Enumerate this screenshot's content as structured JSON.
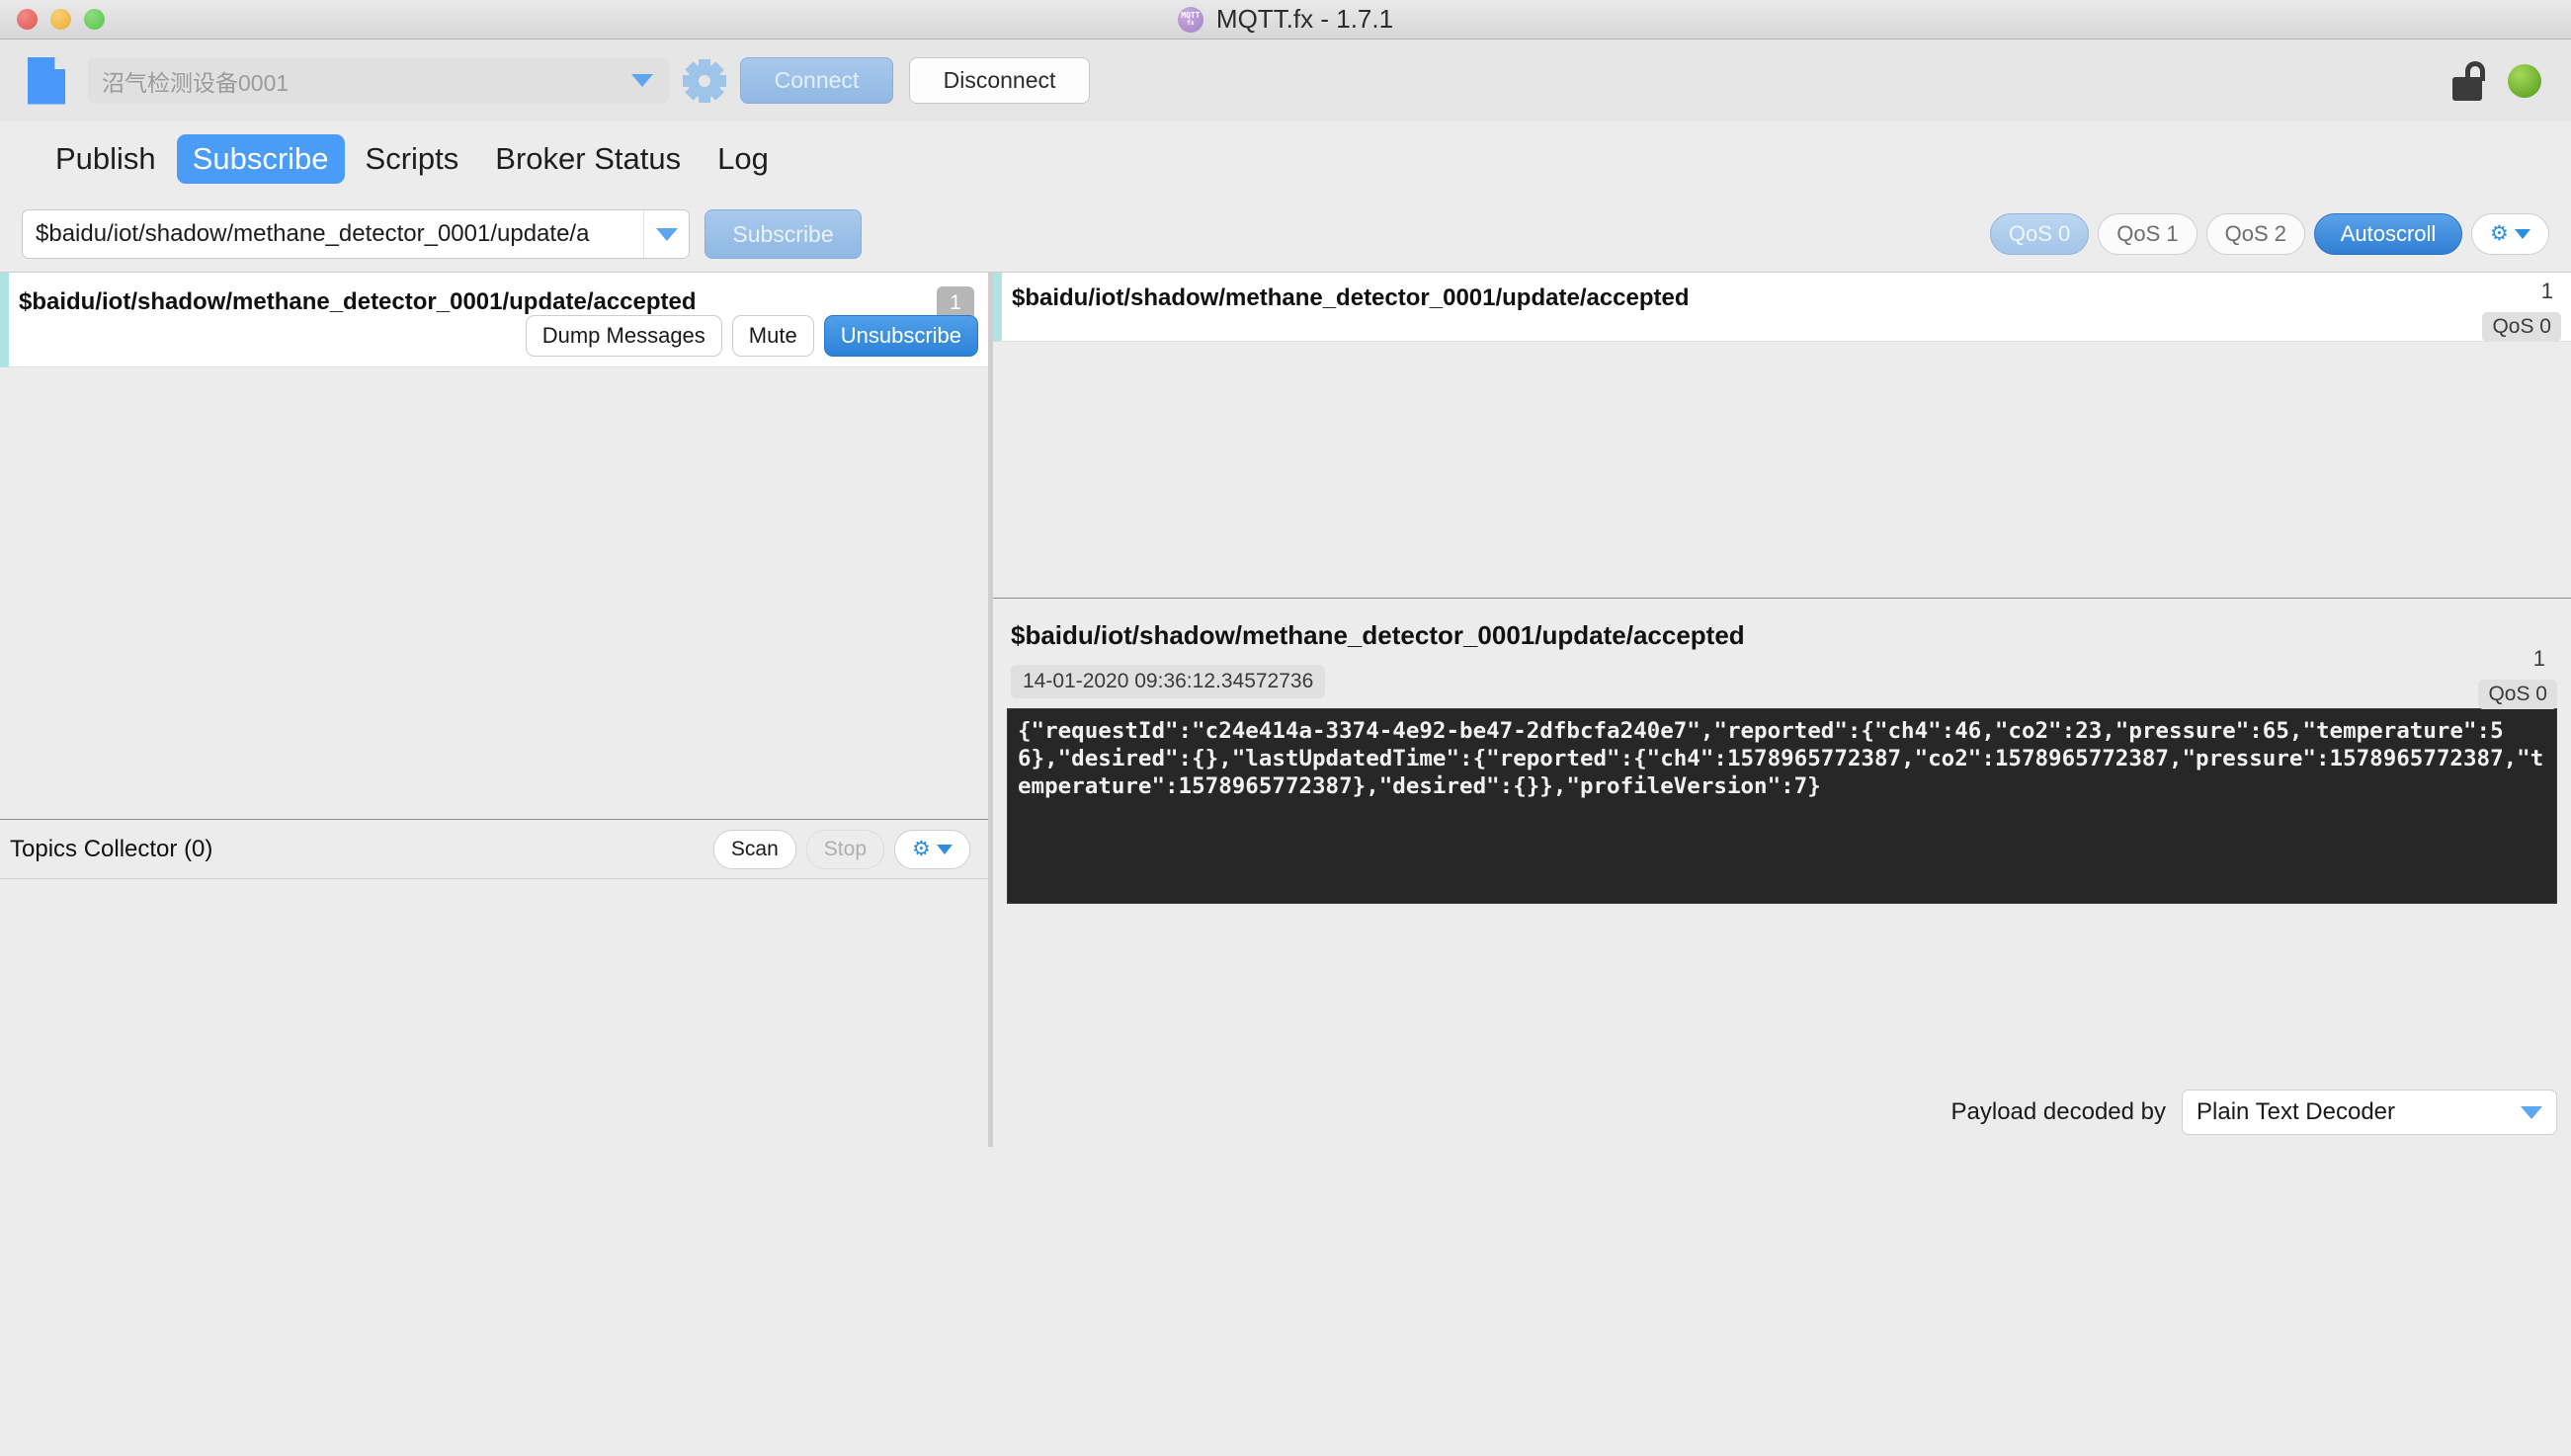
{
  "window": {
    "title": "MQTT.fx - 1.7.1",
    "icon_top": "MQTT",
    "icon_bottom": "fx"
  },
  "toolbar": {
    "connection_profile": "沼气检测设备0001",
    "connect_label": "Connect",
    "disconnect_label": "Disconnect",
    "settings_icon": "gear-icon",
    "lock_icon": "unlocked-padlock-icon",
    "status_icon": "connected-green-led"
  },
  "tabs": [
    {
      "label": "Publish",
      "active": false
    },
    {
      "label": "Subscribe",
      "active": true
    },
    {
      "label": "Scripts",
      "active": false
    },
    {
      "label": "Broker Status",
      "active": false
    },
    {
      "label": "Log",
      "active": false
    }
  ],
  "subscribe_bar": {
    "topic_value": "$baidu/iot/shadow/methane_detector_0001/update/a",
    "subscribe_label": "Subscribe",
    "qos_options": [
      {
        "label": "QoS 0",
        "selected": true
      },
      {
        "label": "QoS 1",
        "selected": false
      },
      {
        "label": "QoS 2",
        "selected": false
      }
    ],
    "autoscroll_label": "Autoscroll",
    "autoscroll_on": true
  },
  "subscriptions": [
    {
      "topic": "$baidu/iot/shadow/methane_detector_0001/update/accepted",
      "count": "1",
      "dump_label": "Dump Messages",
      "mute_label": "Mute",
      "unsubscribe_label": "Unsubscribe"
    }
  ],
  "topics_collector": {
    "label": "Topics Collector (0)",
    "scan_label": "Scan",
    "stop_label": "Stop"
  },
  "messages": [
    {
      "topic": "$baidu/iot/shadow/methane_detector_0001/update/accepted",
      "count": "1",
      "qos": "QoS 0"
    }
  ],
  "detail": {
    "topic": "$baidu/iot/shadow/methane_detector_0001/update/accepted",
    "count": "1",
    "qos": "QoS 0",
    "timestamp": "14-01-2020  09:36:12.34572736",
    "payload": "{\"requestId\":\"c24e414a-3374-4e92-be47-2dfbcfa240e7\",\"reported\":{\"ch4\":46,\"co2\":23,\"pressure\":65,\"temperature\":56},\"desired\":{},\"lastUpdatedTime\":{\"reported\":{\"ch4\":1578965772387,\"co2\":1578965772387,\"pressure\":1578965772387,\"temperature\":1578965772387},\"desired\":{}},\"profileVersion\":7}",
    "decoder_label": "Payload decoded by",
    "decoder_value": "Plain Text Decoder"
  },
  "colors": {
    "accent_blue": "#4a9cf6",
    "active_tab": "#4a9cf6",
    "subscription_stripe": "#aee3e3",
    "payload_bg": "#272727",
    "status_green": "#4e9a17"
  }
}
